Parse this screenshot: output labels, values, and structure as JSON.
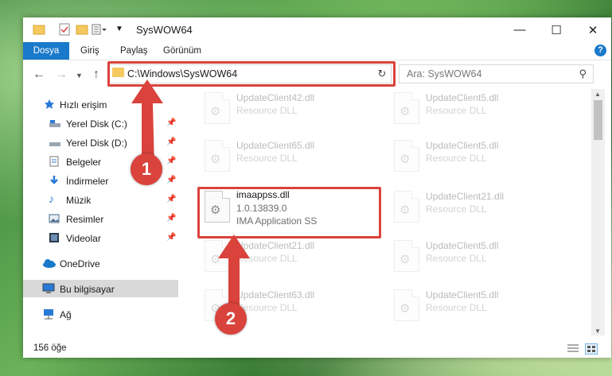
{
  "window": {
    "title": "SysWOW64",
    "minimize_glyph": "—",
    "maximize_glyph": "☐",
    "close_glyph": "✕"
  },
  "ribbon": {
    "tabs": [
      {
        "label": "Dosya",
        "active": true
      },
      {
        "label": "Giriş",
        "active": false
      },
      {
        "label": "Paylaş",
        "active": false
      },
      {
        "label": "Görünüm",
        "active": false
      }
    ],
    "help": "?"
  },
  "navigation": {
    "address": "C:\\Windows\\SysWOW64",
    "search_placeholder": "Ara: SysWOW64"
  },
  "sidebar": {
    "items": [
      {
        "label": "Hızlı erişim",
        "icon": "star-icon",
        "pinned": false
      },
      {
        "label": "Yerel Disk (C:)",
        "icon": "drive-icon",
        "pinned": true
      },
      {
        "label": "Yerel Disk (D:)",
        "icon": "drive-icon",
        "pinned": true
      },
      {
        "label": "Belgeler",
        "icon": "documents-icon",
        "pinned": true
      },
      {
        "label": "İndirmeler",
        "icon": "download-icon",
        "pinned": true
      },
      {
        "label": "Müzik",
        "icon": "music-icon",
        "pinned": true
      },
      {
        "label": "Resimler",
        "icon": "pictures-icon",
        "pinned": true
      },
      {
        "label": "Videolar",
        "icon": "video-icon",
        "pinned": true
      },
      {
        "label": "OneDrive",
        "icon": "cloud-icon",
        "pinned": false
      },
      {
        "label": "Bu bilgisayar",
        "icon": "computer-icon",
        "pinned": false
      },
      {
        "label": "Ağ",
        "icon": "network-icon",
        "pinned": false
      }
    ]
  },
  "files": {
    "left": [
      {
        "name": "UpdateClient42.dll",
        "line2": "Resource DLL",
        "line3": ""
      },
      {
        "name": "UpdateClient65.dll",
        "line2": "Resource DLL",
        "line3": ""
      },
      {
        "name": "imaappss.dll",
        "line2": "1.0.13839.0",
        "line3": "IMA Application SS"
      },
      {
        "name": "UpdateClient21.dll",
        "line2": "Resource DLL",
        "line3": ""
      },
      {
        "name": "UpdateClient63.dll",
        "line2": "Resource DLL",
        "line3": ""
      }
    ],
    "right": [
      {
        "name": "UpdateClient5.dll",
        "line2": "Resource DLL"
      },
      {
        "name": "UpdateClient5.dll",
        "line2": "Resource DLL"
      },
      {
        "name": "UpdateClient21.dll",
        "line2": "Resource DLL"
      },
      {
        "name": "UpdateClient5.dll",
        "line2": "Resource DLL"
      },
      {
        "name": "UpdateClient5.dll",
        "line2": "Resource DLL"
      }
    ]
  },
  "status": {
    "count": "156 öğe"
  },
  "annotations": {
    "badge1": "1",
    "badge2": "2",
    "color": "#d9433c"
  }
}
